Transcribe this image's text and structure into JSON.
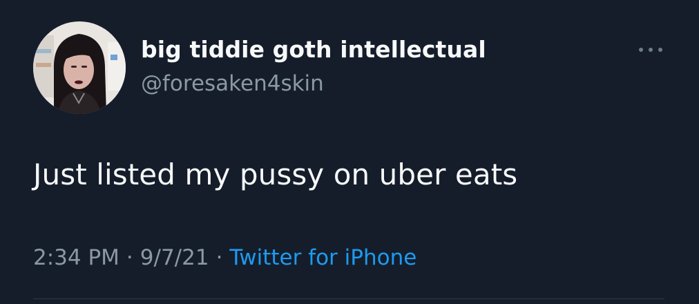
{
  "tweet": {
    "display_name": "big tiddie goth intellectual",
    "handle": "@foresaken4skin",
    "text": "Just listed my pussy on uber eats",
    "time": "2:34 PM",
    "date": "9/7/21",
    "separator": "·",
    "source": "Twitter for iPhone"
  },
  "icons": {
    "more": "more-horizontal-icon",
    "avatar": "profile-photo"
  },
  "colors": {
    "background": "#151d2b",
    "primary_text": "#f7f9f9",
    "secondary_text": "#8b98a5",
    "link": "#1d9bf0"
  }
}
